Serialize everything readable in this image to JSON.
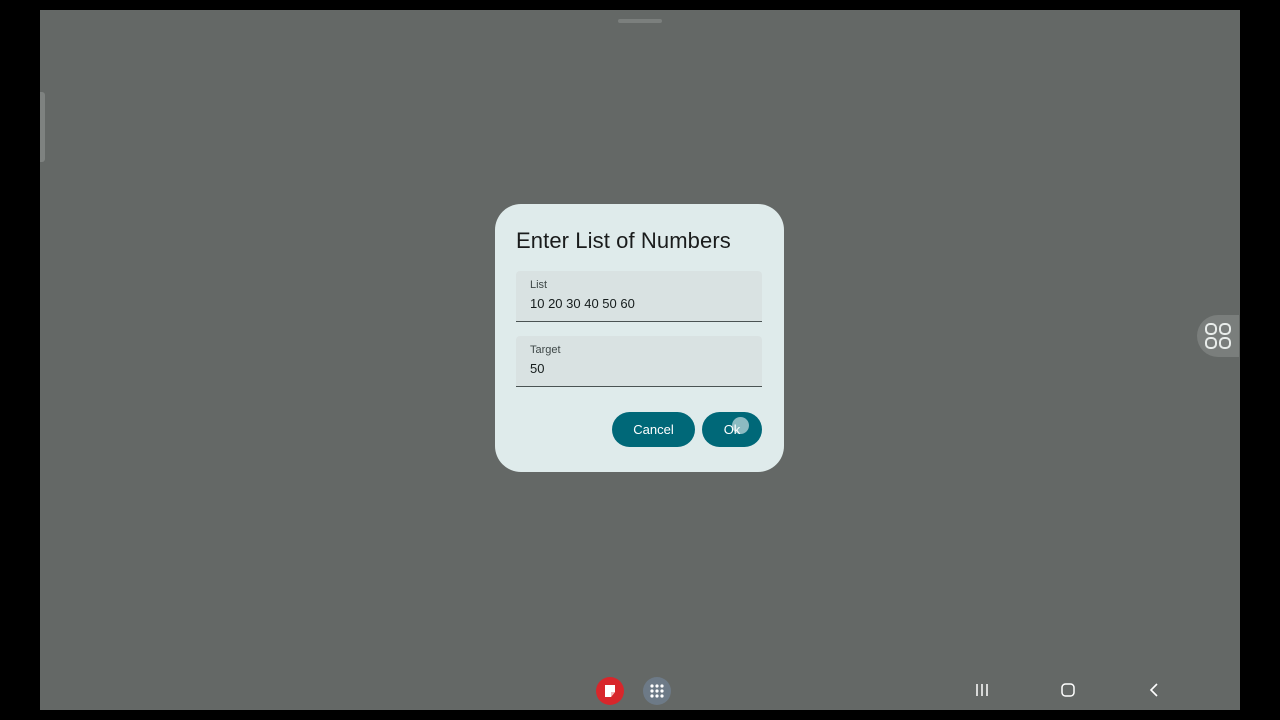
{
  "dialog": {
    "title": "Enter List of Numbers",
    "fields": [
      {
        "label": "List",
        "value": "10 20 30 40 50 60"
      },
      {
        "label": "Target",
        "value": "50"
      }
    ],
    "buttons": {
      "cancel_label": "Cancel",
      "ok_label": "Ok"
    }
  },
  "taskbar": {
    "apps": [
      {
        "icon": "notes-app-icon",
        "color": "#d8262b"
      },
      {
        "icon": "app-drawer-icon",
        "color": "#6d7a87"
      }
    ],
    "nav": [
      "recents-icon",
      "home-icon",
      "back-icon"
    ]
  },
  "colors": {
    "screen_bg": "#646866",
    "dialog_bg": "#dfebeb",
    "button_accent": "#006878"
  }
}
